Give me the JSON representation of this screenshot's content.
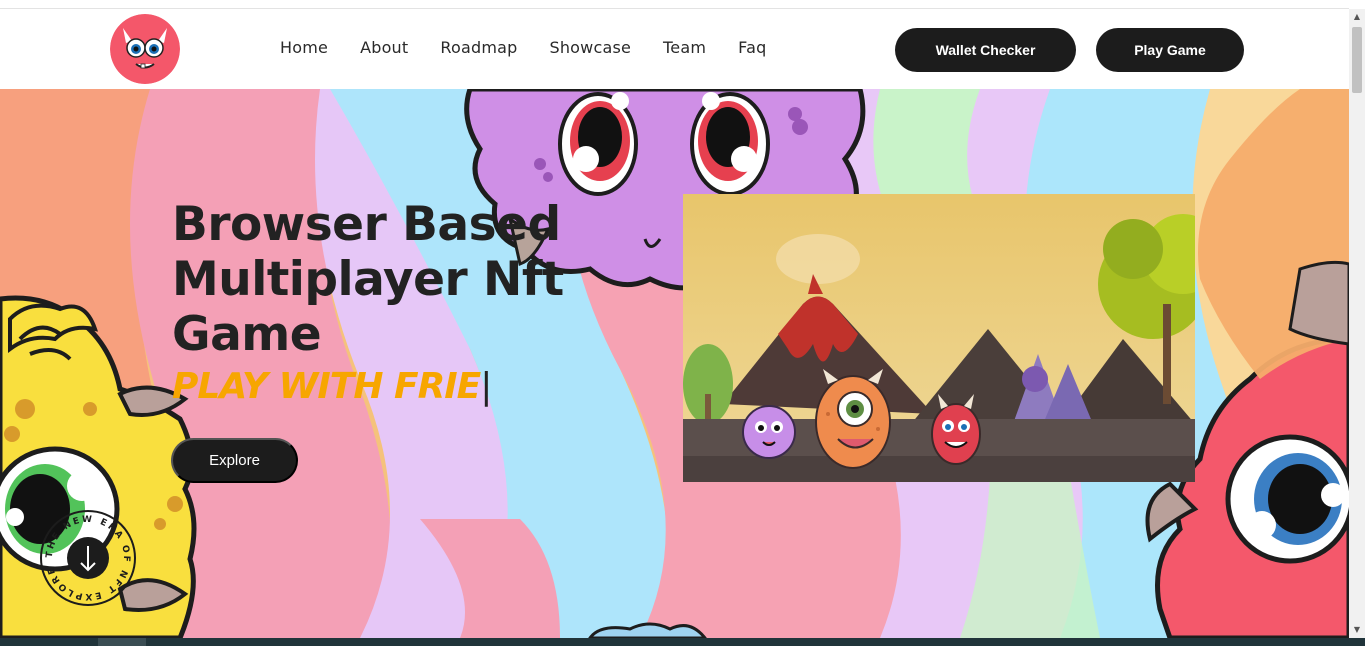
{
  "nav": {
    "links": [
      "Home",
      "About",
      "Roadmap",
      "Showcase",
      "Team",
      "Faq"
    ],
    "wallet_button": "Wallet Checker",
    "play_button": "Play Game"
  },
  "hero": {
    "headline": "Browser Based Multiplayer Nft Game",
    "typing_text": "PLAY WITH FRIE",
    "cursor": "|",
    "explore_button": "Explore",
    "badge_text": "THE NEW ERA OF NFT EXPLORE"
  },
  "icons": {
    "logo": "red-monster-logo-icon",
    "badge_arrow": "arrow-down-icon"
  },
  "colors": {
    "accent_orange": "#f7a600",
    "button_dark": "#1c1c1c",
    "text_dark": "#222222"
  }
}
